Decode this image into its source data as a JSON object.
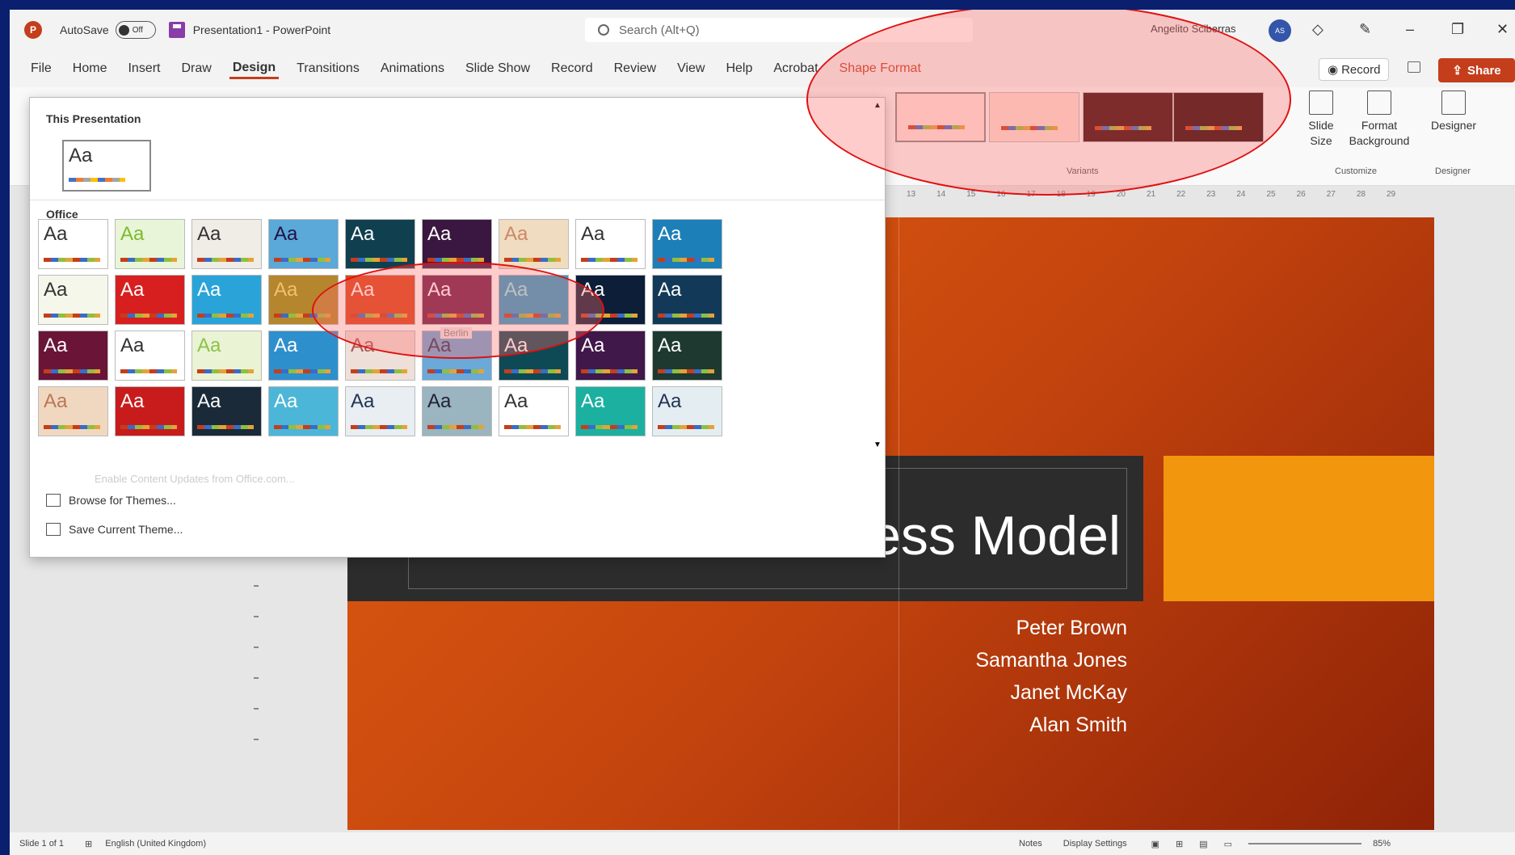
{
  "titlebar": {
    "autosave_label": "AutoSave",
    "autosave_state": "Off",
    "doc_title": "Presentation1 - PowerPoint",
    "search_placeholder": "Search (Alt+Q)",
    "user_name": "Angelito Sciberras"
  },
  "menu": {
    "tabs": [
      "File",
      "Home",
      "Insert",
      "Draw",
      "Design",
      "Transitions",
      "Animations",
      "Slide Show",
      "Record",
      "Review",
      "View",
      "Help",
      "Acrobat",
      "Shape Format"
    ],
    "active_tab": "Design",
    "record_label": "Record",
    "share_label": "Share"
  },
  "ribbon": {
    "variants_label": "Variants",
    "customize_label": "Customize",
    "designer_group_label": "Designer",
    "slide_size_label": "Slide Size",
    "format_background_label": "Format Background",
    "designer_label": "Designer",
    "ruler_ticks": [
      "13",
      "14",
      "15",
      "16",
      "17",
      "18",
      "19",
      "20",
      "21",
      "22",
      "23",
      "24",
      "25",
      "26",
      "27",
      "28",
      "29"
    ]
  },
  "gallery": {
    "this_presentation_label": "This Presentation",
    "office_label": "Office",
    "current_theme_aa": "Aa",
    "tooltip": "Berlin",
    "faded_text": "Enable Content Updates from Office.com...",
    "browse_label": "Browse for Themes...",
    "save_label": "Save Current Theme...",
    "thumb_text": "Aa"
  },
  "slide": {
    "title": "Our Business Model",
    "authors": [
      "Peter Brown",
      "Samantha Jones",
      "Janet McKay",
      "Alan Smith"
    ]
  },
  "statusbar": {
    "slide_info": "Slide 1 of 1",
    "language": "English (United Kingdom)",
    "notes_label": "Notes",
    "display_settings_label": "Display Settings",
    "zoom": "85%"
  },
  "colors": {
    "accent": "#c43e1c",
    "frame": "#0a1f6e",
    "annotation": "#e01010"
  }
}
